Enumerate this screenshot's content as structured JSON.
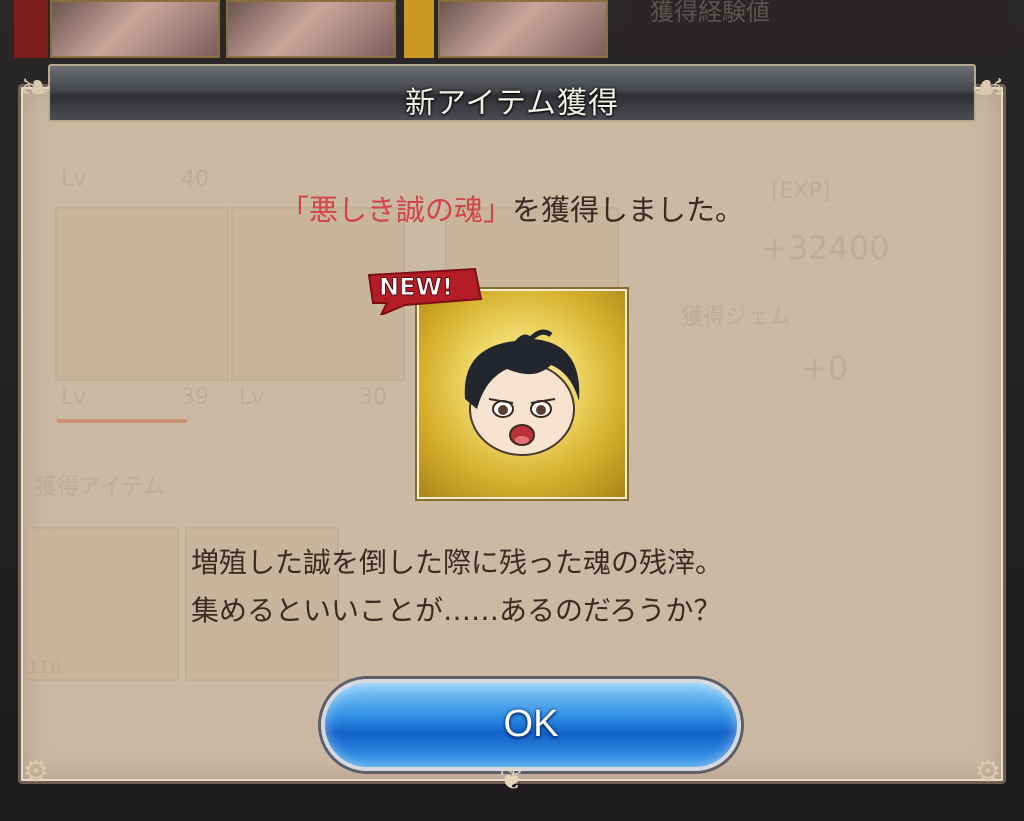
{
  "dialog": {
    "title": "新アイテム獲得",
    "item_name": "「悪しき誠の魂」",
    "obtained_suffix": "を獲得しました。",
    "new_badge": "NEW!",
    "description_line1": "増殖した誠を倒した際に残った魂の残滓。",
    "description_line2": "集めるといいことが……あるのだろうか？",
    "ok_label": "OK"
  },
  "background": {
    "top_right_label": "獲得経験値",
    "exp_label": "[EXP]",
    "exp_value": "+32400",
    "gem_label": "獲得ジェム",
    "gem_value": "+0",
    "items_label": "獲得アイテム",
    "lv_label": "Lv",
    "levels": [
      "40",
      "39",
      "30"
    ],
    "item_count": "116"
  },
  "colors": {
    "item_name": "#d2454a",
    "ok_button": "#1261c8",
    "dialog_bg": "#cbb9a4"
  }
}
